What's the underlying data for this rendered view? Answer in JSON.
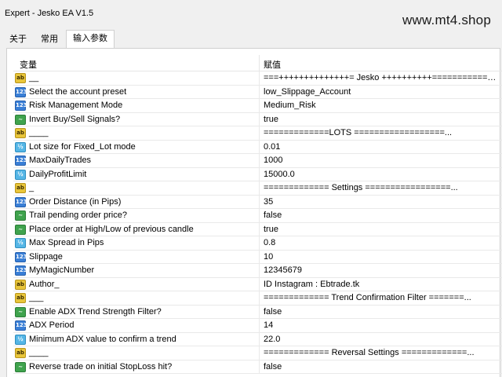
{
  "window": {
    "title": "Expert - Jesko EA V1.5",
    "watermark": "www.mt4.shop"
  },
  "tabs": [
    "关于",
    "常用",
    "输入参数"
  ],
  "table": {
    "headers": [
      "变量",
      "赋值"
    ],
    "rows": [
      {
        "type": "string",
        "icon": "ab",
        "name": "__",
        "value": "===++++++++++++++= Jesko ++++++++++============..."
      },
      {
        "type": "int",
        "icon": "123",
        "name": "Select the account preset",
        "value": "low_Slippage_Account"
      },
      {
        "type": "int",
        "icon": "123",
        "name": "Risk Management Mode",
        "value": "Medium_Risk"
      },
      {
        "type": "bool",
        "icon": "~",
        "name": "Invert Buy/Sell Signals?",
        "value": "true"
      },
      {
        "type": "string",
        "icon": "ab",
        "name": "____",
        "value": "=============LOTS ==================..."
      },
      {
        "type": "double",
        "icon": "½",
        "name": "Lot size for Fixed_Lot mode",
        "value": "0.01"
      },
      {
        "type": "int",
        "icon": "123",
        "name": "MaxDailyTrades",
        "value": "1000"
      },
      {
        "type": "double",
        "icon": "½",
        "name": "DailyProfitLimit",
        "value": "15000.0"
      },
      {
        "type": "string",
        "icon": "ab",
        "name": "_",
        "value": "============= Settings =================..."
      },
      {
        "type": "int",
        "icon": "123",
        "name": "Order Distance (in Pips)",
        "value": "35"
      },
      {
        "type": "bool",
        "icon": "~",
        "name": "Trail pending order price?",
        "value": "false"
      },
      {
        "type": "bool",
        "icon": "~",
        "name": "Place order at High/Low of previous candle",
        "value": "true"
      },
      {
        "type": "double",
        "icon": "½",
        "name": "Max Spread in Pips",
        "value": "0.8"
      },
      {
        "type": "int",
        "icon": "123",
        "name": "Slippage",
        "value": "10"
      },
      {
        "type": "int",
        "icon": "123",
        "name": "MyMagicNumber",
        "value": "12345679"
      },
      {
        "type": "string",
        "icon": "ab",
        "name": "Author_",
        "value": "ID Instagram : Ebtrade.tk"
      },
      {
        "type": "string",
        "icon": "ab",
        "name": "___",
        "value": "============= Trend Confirmation Filter =======..."
      },
      {
        "type": "bool",
        "icon": "~",
        "name": "Enable ADX Trend Strength Filter?",
        "value": "false"
      },
      {
        "type": "int",
        "icon": "123",
        "name": "ADX Period",
        "value": "14"
      },
      {
        "type": "double",
        "icon": "½",
        "name": "Minimum ADX value to confirm a trend",
        "value": "22.0"
      },
      {
        "type": "string",
        "icon": "ab",
        "name": "____",
        "value": "============= Reversal Settings =============..."
      },
      {
        "type": "bool",
        "icon": "~",
        "name": "Reverse trade on initial StopLoss hit?",
        "value": "false"
      }
    ]
  }
}
